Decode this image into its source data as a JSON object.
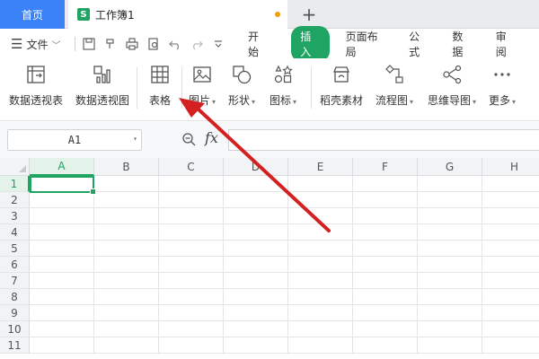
{
  "tabs": {
    "home_label": "首页",
    "doc_badge": "S",
    "doc_title": "工作簿1",
    "new_tab_glyph": "+"
  },
  "menu": {
    "file_label": "文件",
    "tabs": [
      "开始",
      "插入",
      "页面布局",
      "公式",
      "数据",
      "审阅"
    ],
    "active_tab": "插入"
  },
  "ribbon": {
    "buttons": [
      {
        "label": "数据透视表",
        "icon": "pivot-table-icon",
        "dropdown": false
      },
      {
        "label": "数据透视图",
        "icon": "pivot-chart-icon",
        "dropdown": false
      },
      {
        "label": "表格",
        "icon": "table-icon",
        "dropdown": false
      },
      {
        "label": "图片",
        "icon": "picture-icon",
        "dropdown": true
      },
      {
        "label": "形状",
        "icon": "shapes-icon",
        "dropdown": true
      },
      {
        "label": "图标",
        "icon": "icons-icon",
        "dropdown": true
      },
      {
        "label": "稻壳素材",
        "icon": "docer-material-icon",
        "dropdown": false
      },
      {
        "label": "流程图",
        "icon": "flowchart-icon",
        "dropdown": true
      },
      {
        "label": "思维导图",
        "icon": "mindmap-icon",
        "dropdown": true
      },
      {
        "label": "更多",
        "icon": "more-icon",
        "dropdown": true
      }
    ]
  },
  "formula_bar": {
    "name_box": "A1",
    "fx_label": "fx",
    "formula": ""
  },
  "sheet": {
    "columns": [
      "A",
      "B",
      "C",
      "D",
      "E",
      "F",
      "G",
      "H"
    ],
    "rows": [
      "1",
      "2",
      "3",
      "4",
      "5",
      "6",
      "7",
      "8",
      "9",
      "10",
      "11"
    ],
    "selected_cell": "A1"
  },
  "colors": {
    "accent_green": "#1fa463",
    "home_tab_blue": "#3b82f6",
    "annotation_red": "#d42020"
  }
}
